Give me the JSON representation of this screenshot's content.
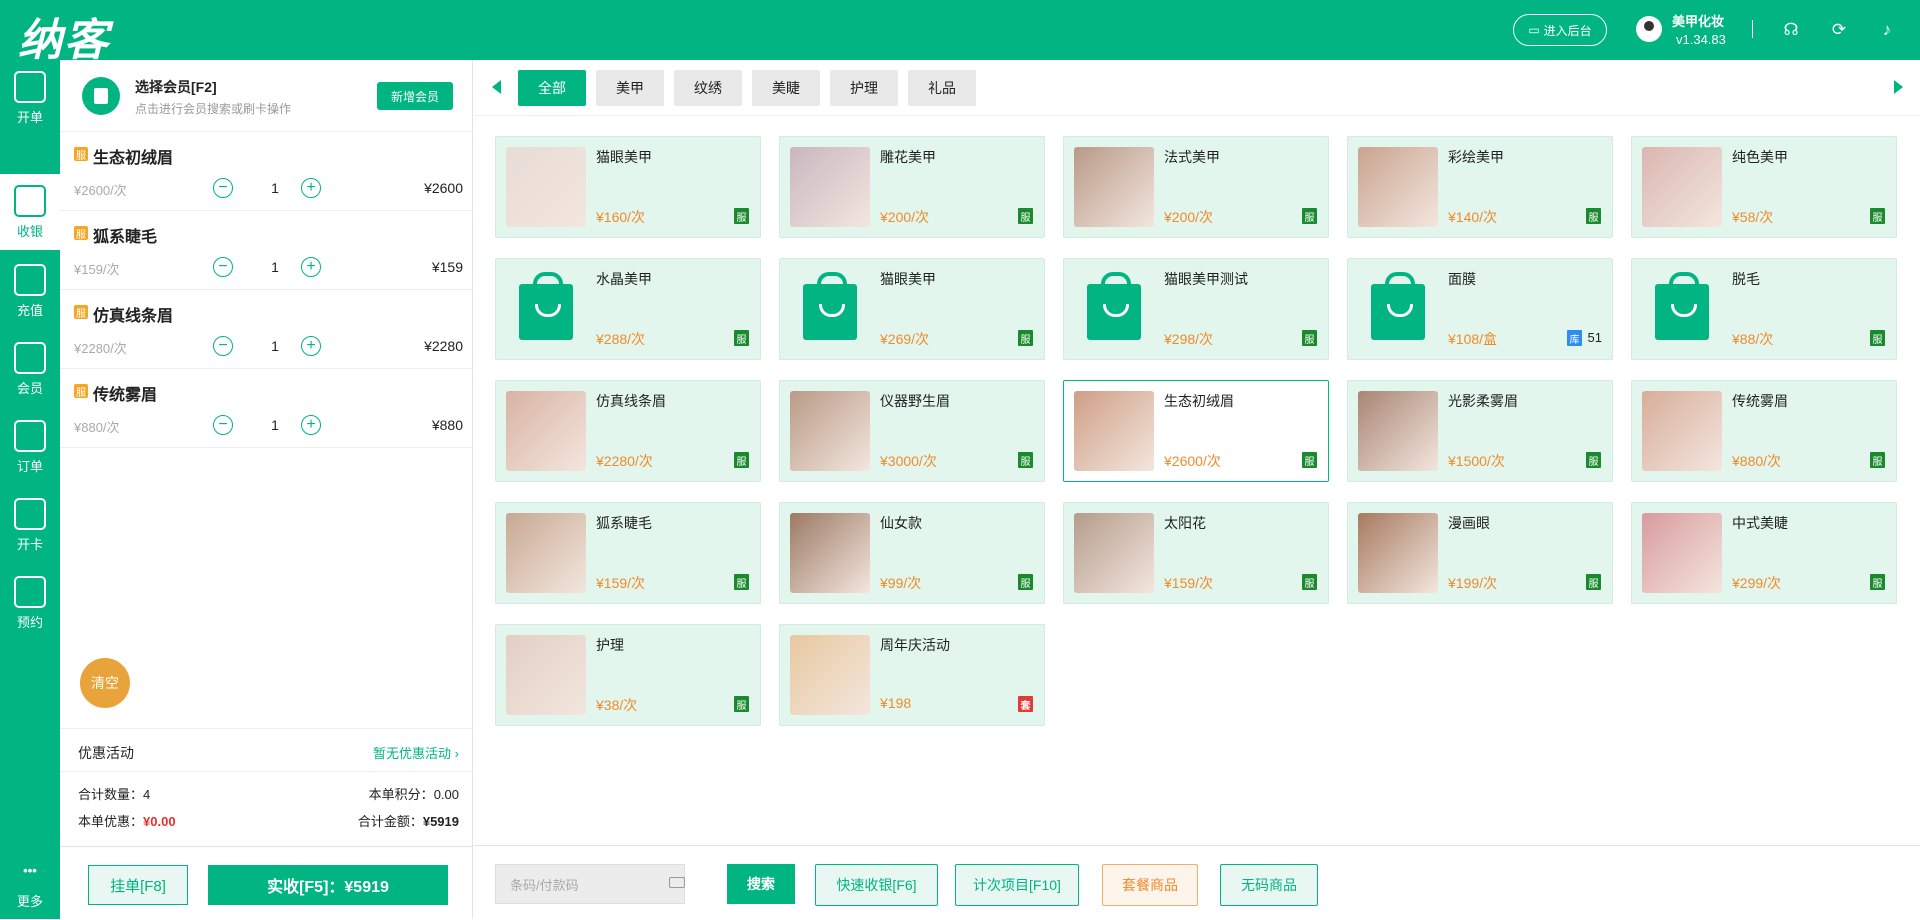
{
  "app": {
    "logo": "纳客"
  },
  "header": {
    "backend_label": "进入后台",
    "user_name": "美甲化妆",
    "version": "v1.34.83"
  },
  "sidebar": {
    "items": [
      {
        "label": "开单",
        "icon": "edit-icon"
      },
      {
        "label": "收银",
        "icon": "cashier-icon"
      },
      {
        "label": "充值",
        "icon": "recharge-icon"
      },
      {
        "label": "会员",
        "icon": "member-icon"
      },
      {
        "label": "订单",
        "icon": "order-icon"
      },
      {
        "label": "开卡",
        "icon": "vip-card-icon"
      },
      {
        "label": "预约",
        "icon": "calendar-icon"
      },
      {
        "label": "更多",
        "icon": "more-icon"
      }
    ],
    "active": "收银"
  },
  "member": {
    "title": "选择会员[F2]",
    "subtitle": "点击进行会员搜索或刷卡操作",
    "new_label": "新增会员"
  },
  "cart": {
    "badge": "服",
    "items": [
      {
        "name": "生态初绒眉",
        "unit": "¥2600/次",
        "qty": "1",
        "total": "¥2600"
      },
      {
        "name": "狐系睫毛",
        "unit": "¥159/次",
        "qty": "1",
        "total": "¥159"
      },
      {
        "name": "仿真线条眉",
        "unit": "¥2280/次",
        "qty": "1",
        "total": "¥2280"
      },
      {
        "name": "传统雾眉",
        "unit": "¥880/次",
        "qty": "1",
        "total": "¥880"
      }
    ],
    "clear_label": "清空"
  },
  "summary": {
    "promo_label": "优惠活动",
    "promo_value": "暂无优惠活动",
    "count_label": "合计数量：",
    "count_value": "4",
    "points_label": "本单积分：",
    "points_value": "0.00",
    "discount_label": "本单优惠：",
    "discount_value": "¥0.00",
    "amount_label": "合计金额：",
    "amount_value": "¥5919"
  },
  "checkout": {
    "hold_label": "挂单[F8]",
    "pay_label": "实收[F5]：¥5919"
  },
  "tabs": [
    "全部",
    "美甲",
    "纹绣",
    "美睫",
    "护理",
    "礼品"
  ],
  "active_tab": "全部",
  "products": [
    {
      "name": "猫眼美甲",
      "price": "¥160/次",
      "tag": "服",
      "thumb": "#e8dcd6"
    },
    {
      "name": "雕花美甲",
      "price": "¥200/次",
      "tag": "服",
      "thumb": "#c9b6c0"
    },
    {
      "name": "法式美甲",
      "price": "¥200/次",
      "tag": "服",
      "thumb": "#b89a88"
    },
    {
      "name": "彩绘美甲",
      "price": "¥140/次",
      "tag": "服",
      "thumb": "#c9a48f"
    },
    {
      "name": "纯色美甲",
      "price": "¥58/次",
      "tag": "服",
      "thumb": "#d9b7b0"
    },
    {
      "name": "水晶美甲",
      "price": "¥288/次",
      "tag": "服",
      "thumb": "bag"
    },
    {
      "name": "猫眼美甲",
      "price": "¥269/次",
      "tag": "服",
      "thumb": "bag"
    },
    {
      "name": "猫眼美甲测试",
      "price": "¥298/次",
      "tag": "服",
      "thumb": "bag"
    },
    {
      "name": "面膜",
      "price": "¥108/盒",
      "tag": "库",
      "stock": "51",
      "thumb": "bag"
    },
    {
      "name": "脱毛",
      "price": "¥88/次",
      "tag": "服",
      "thumb": "bag"
    },
    {
      "name": "仿真线条眉",
      "price": "¥2280/次",
      "tag": "服",
      "thumb": "#d8b3a3"
    },
    {
      "name": "仪器野生眉",
      "price": "¥3000/次",
      "tag": "服",
      "thumb": "#b99a87"
    },
    {
      "name": "生态初绒眉",
      "price": "¥2600/次",
      "tag": "服",
      "thumb": "#cf9f86",
      "selected": true
    },
    {
      "name": "光影柔雾眉",
      "price": "¥1500/次",
      "tag": "服",
      "thumb": "#a88674"
    },
    {
      "name": "传统雾眉",
      "price": "¥880/次",
      "tag": "服",
      "thumb": "#d8ad9a"
    },
    {
      "name": "狐系睫毛",
      "price": "¥159/次",
      "tag": "服",
      "thumb": "#c7a993"
    },
    {
      "name": "仙女款",
      "price": "¥99/次",
      "tag": "服",
      "thumb": "#9c7a65"
    },
    {
      "name": "太阳花",
      "price": "¥159/次",
      "tag": "服",
      "thumb": "#b59c8c"
    },
    {
      "name": "漫画眼",
      "price": "¥199/次",
      "tag": "服",
      "thumb": "#a77a60"
    },
    {
      "name": "中式美睫",
      "price": "¥299/次",
      "tag": "服",
      "thumb": "#d99aa0"
    },
    {
      "name": "护理",
      "price": "¥38/次",
      "tag": "服",
      "thumb": "#e2cfc4"
    },
    {
      "name": "周年庆活动",
      "price": "¥198",
      "tag": "套",
      "thumb": "#e8c9a0"
    }
  ],
  "bottom": {
    "search_placeholder": "条码/付款码",
    "search_label": "搜索",
    "actions": [
      {
        "label": "快速收银[F6]",
        "style": "green"
      },
      {
        "label": "计次项目[F10]",
        "style": "green"
      },
      {
        "label": "套餐商品",
        "style": "orange"
      },
      {
        "label": "无码商品",
        "style": "green"
      }
    ]
  },
  "colors": {
    "brand": "#00b582",
    "price": "#f08b2a",
    "service_tag": "#1a8a2e",
    "package_tag": "#e53935",
    "stock_tag": "#2d8cf0",
    "clear": "#e8a33a"
  }
}
